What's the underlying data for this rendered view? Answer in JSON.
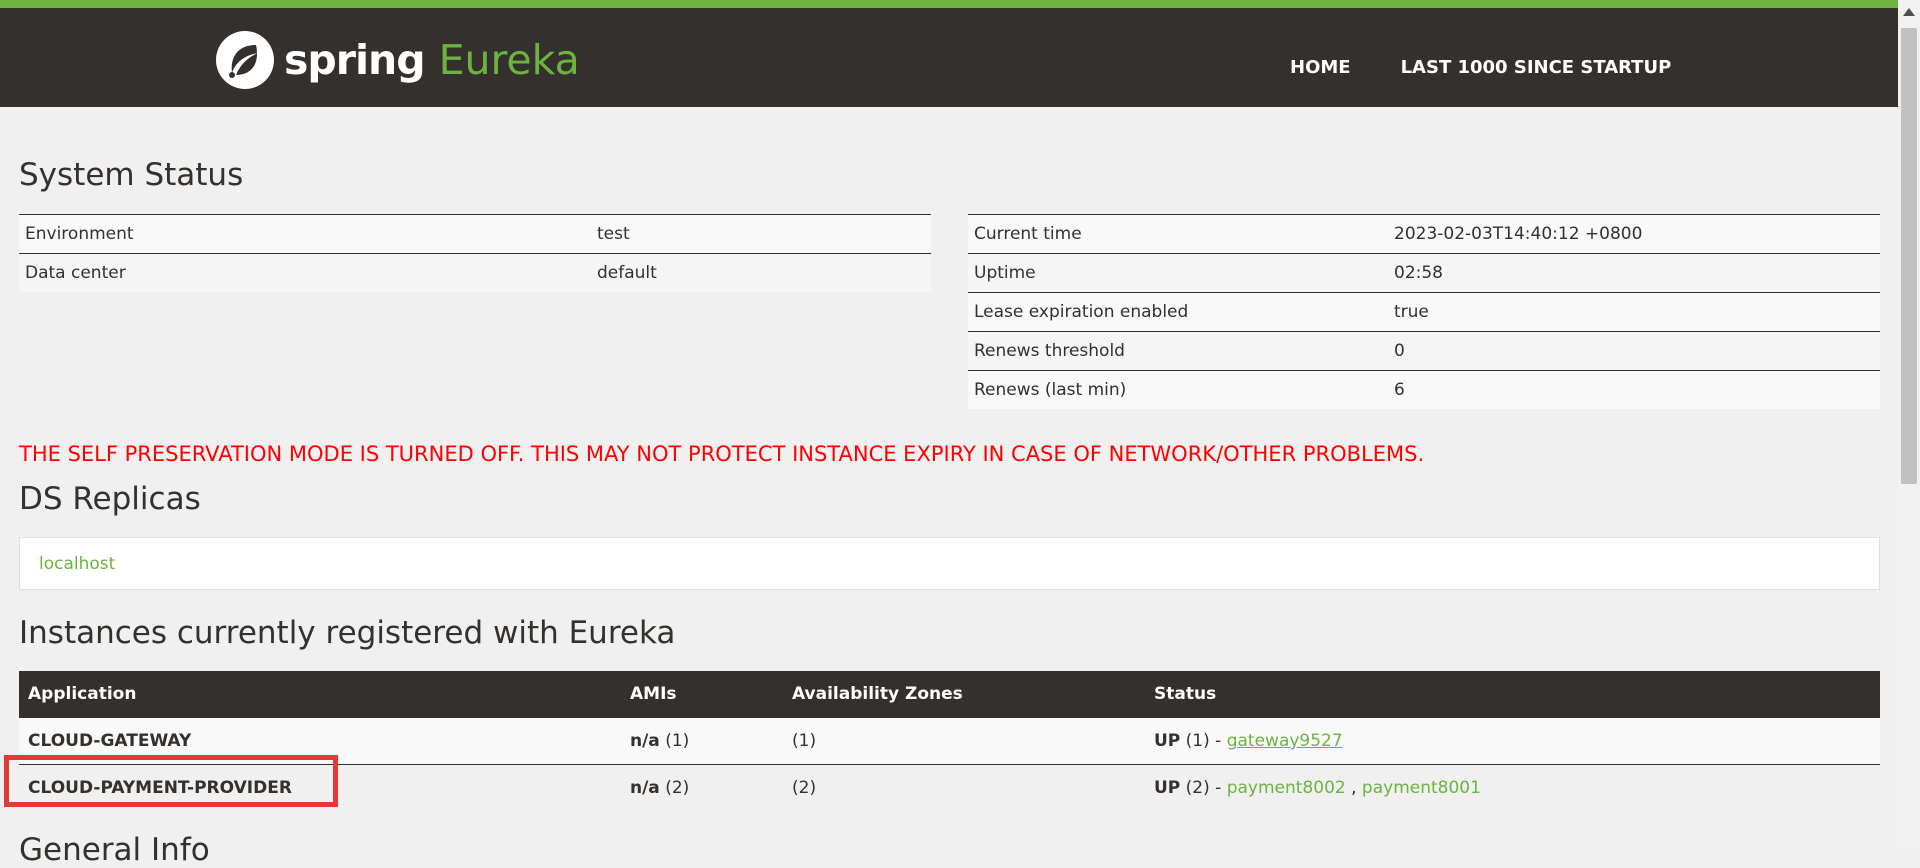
{
  "brand": {
    "spring": "spring",
    "eureka": "Eureka"
  },
  "nav": {
    "home": "HOME",
    "last1000": "LAST 1000 SINCE STARTUP"
  },
  "system_status": {
    "title": "System Status",
    "left": [
      {
        "key": "Environment",
        "value": "test"
      },
      {
        "key": "Data center",
        "value": "default"
      }
    ],
    "right": [
      {
        "key": "Current time",
        "value": "2023-02-03T14:40:12 +0800"
      },
      {
        "key": "Uptime",
        "value": "02:58"
      },
      {
        "key": "Lease expiration enabled",
        "value": "true"
      },
      {
        "key": "Renews threshold",
        "value": "0"
      },
      {
        "key": "Renews (last min)",
        "value": "6"
      }
    ]
  },
  "warning": "THE SELF PRESERVATION MODE IS TURNED OFF. THIS MAY NOT PROTECT INSTANCE EXPIRY IN CASE OF NETWORK/OTHER PROBLEMS.",
  "replicas": {
    "title": "DS Replicas",
    "items": [
      "localhost"
    ]
  },
  "instances": {
    "title": "Instances currently registered with Eureka",
    "headers": [
      "Application",
      "AMIs",
      "Availability Zones",
      "Status"
    ],
    "rows": [
      {
        "application": "CLOUD-GATEWAY",
        "ami_label": "n/a",
        "ami_count": "(1)",
        "zones": "(1)",
        "status_label": "UP",
        "status_count": "(1) -",
        "links": [
          "gateway9527"
        ]
      },
      {
        "application": "CLOUD-PAYMENT-PROVIDER",
        "ami_label": "n/a",
        "ami_count": "(2)",
        "zones": "(2)",
        "status_label": "UP",
        "status_count": "(2) -",
        "links": [
          "payment8002",
          "payment8001"
        ],
        "link_separator": ","
      }
    ]
  },
  "general_info": {
    "title": "General Info"
  },
  "colors": {
    "brand_green": "#6db33f",
    "nav_dark": "#34302d",
    "warning_red": "#ff0000",
    "highlight_box": "#e53935"
  }
}
